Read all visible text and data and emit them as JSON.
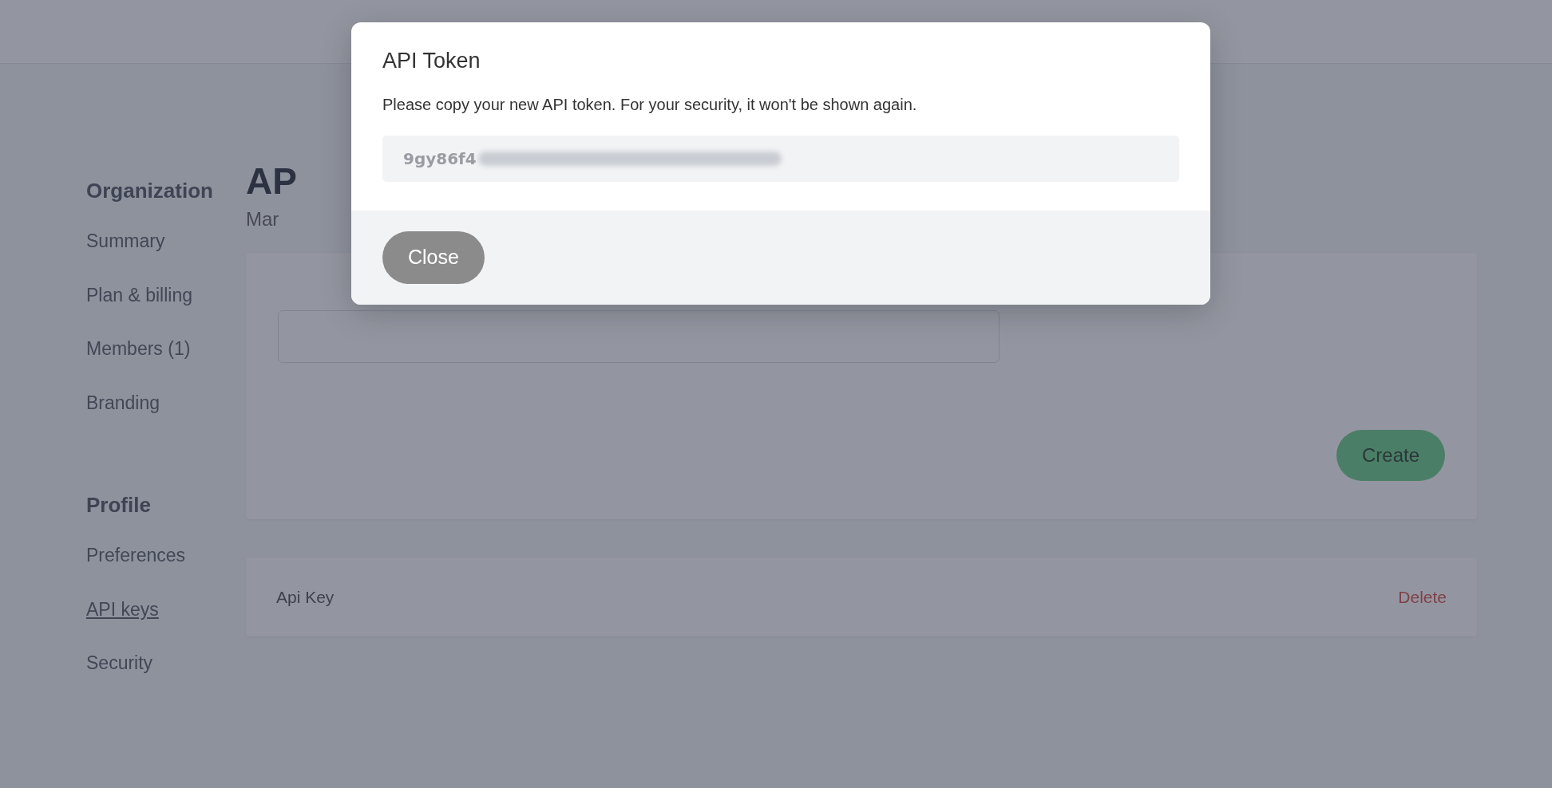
{
  "sidebar": {
    "sections": [
      {
        "title": "Organization",
        "items": [
          {
            "label": "Summary",
            "selected": false
          },
          {
            "label": "Plan & billing",
            "selected": false
          },
          {
            "label": "Members (1)",
            "selected": false
          },
          {
            "label": "Branding",
            "selected": false
          }
        ]
      },
      {
        "title": "Profile",
        "items": [
          {
            "label": "Preferences",
            "selected": false
          },
          {
            "label": "API keys",
            "selected": true
          },
          {
            "label": "Security",
            "selected": false
          }
        ]
      }
    ]
  },
  "page": {
    "title": "AP",
    "subtitle": "Mar"
  },
  "create_form": {
    "button": "Create"
  },
  "keys": [
    {
      "name": "Api Key",
      "action": "Delete"
    }
  ],
  "modal": {
    "title": "API Token",
    "message": "Please copy your new API token. For your security, it won't be shown again.",
    "token": "9gy86f4",
    "footer_button": "Close"
  }
}
